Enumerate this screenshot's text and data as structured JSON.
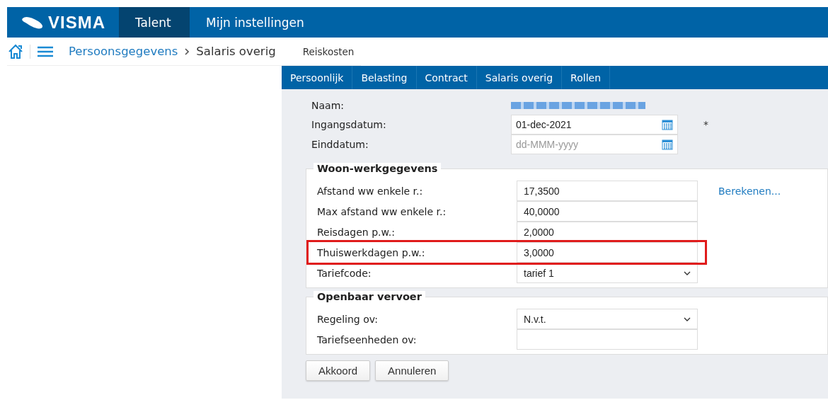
{
  "top_bar": {
    "logo": "VISMA",
    "tabs": [
      {
        "label": "Talent",
        "selected": true
      },
      {
        "label": "Mijn instellingen",
        "selected": false
      }
    ]
  },
  "breadcrumb": {
    "items": [
      "Persoonsgegevens",
      "Salaris overig"
    ],
    "subpage": "Reiskosten"
  },
  "tabs": [
    {
      "label": "Persoonlijk",
      "selected": false
    },
    {
      "label": "Belasting",
      "selected": false
    },
    {
      "label": "Contract",
      "selected": false
    },
    {
      "label": "Salaris overig",
      "selected": false
    },
    {
      "label": "Rollen",
      "selected": false
    }
  ],
  "header_fields": [
    {
      "label": "Naam:",
      "kind": "redacted"
    },
    {
      "label": "Ingangsdatum:",
      "kind": "date",
      "value": "01-dec-2021",
      "required_mark": "*"
    },
    {
      "label": "Einddatum:",
      "kind": "date",
      "placeholder": "dd-MMM-yyyy"
    }
  ],
  "fieldsets": [
    {
      "legend": "Woon-werkgegevens",
      "rows": [
        {
          "label": "Afstand ww enkele r.:",
          "kind": "text",
          "value": "17,3500",
          "link": "Berekenen..."
        },
        {
          "label": "Max afstand ww enkele r.:",
          "kind": "text",
          "value": "40,0000"
        },
        {
          "label": "Reisdagen p.w.:",
          "kind": "text",
          "value": "2,0000"
        },
        {
          "label": "Thuiswerkdagen p.w.:",
          "kind": "text",
          "value": "3,0000",
          "highlighted": true
        },
        {
          "label": "Tariefcode:",
          "kind": "select",
          "value": "tarief 1"
        }
      ]
    },
    {
      "legend": "Openbaar vervoer",
      "rows": [
        {
          "label": "Regeling ov:",
          "kind": "select",
          "value": "N.v.t."
        },
        {
          "label": "Tariefseenheden ov:",
          "kind": "text"
        }
      ]
    }
  ],
  "buttons": [
    "Akkoord",
    "Annuleren"
  ]
}
